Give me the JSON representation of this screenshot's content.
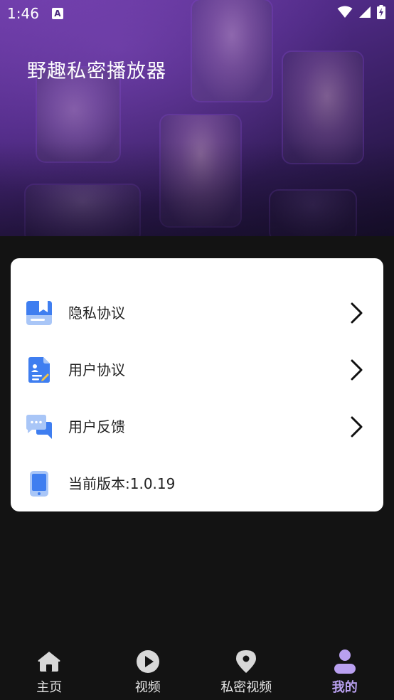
{
  "status_bar": {
    "time": "1:46",
    "notification_icon": "A"
  },
  "header": {
    "app_title": "野趣私密播放器"
  },
  "menu": {
    "items": [
      {
        "label": "隐私协议",
        "icon": "book-icon"
      },
      {
        "label": "用户协议",
        "icon": "document-user-icon"
      },
      {
        "label": "用户反馈",
        "icon": "chat-bubble-icon"
      },
      {
        "label": "当前版本:1.0.19",
        "icon": "phone-icon"
      }
    ]
  },
  "bottom_nav": {
    "items": [
      {
        "label": "主页",
        "icon": "home-icon"
      },
      {
        "label": "视频",
        "icon": "play-icon"
      },
      {
        "label": "私密视频",
        "icon": "location-pin-icon"
      },
      {
        "label": "我的",
        "icon": "profile-icon"
      }
    ],
    "active_index": 3
  },
  "colors": {
    "accent": "#b9a0f0",
    "card_bg": "#ffffff",
    "page_bg": "#131313",
    "icon_blue": "#3f7ef0",
    "icon_light_blue": "#a9c6f7"
  }
}
